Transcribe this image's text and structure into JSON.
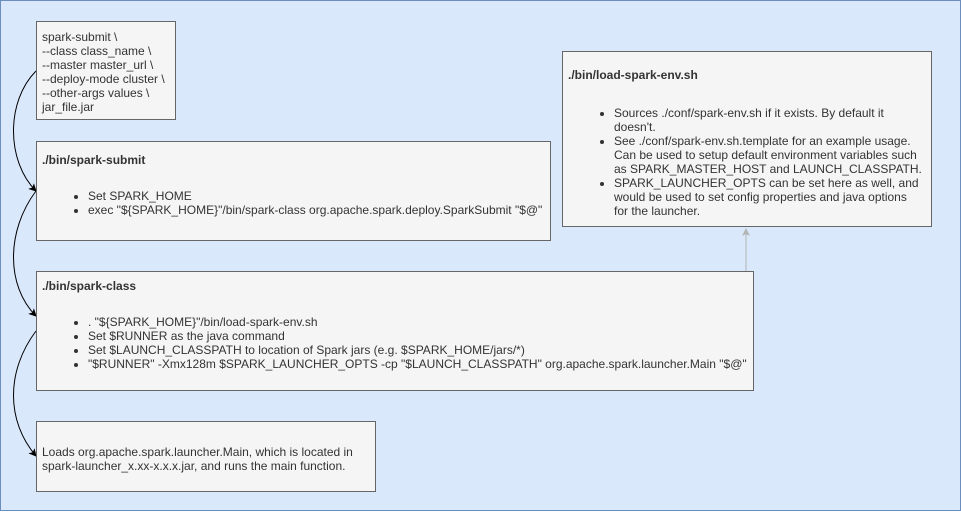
{
  "boxes": {
    "cmd": {
      "lines": [
        "spark-submit \\",
        "--class class_name \\",
        "--master master_url \\",
        "--deploy-mode cluster \\",
        "--other-args values \\",
        "jar_file.jar"
      ]
    },
    "submit": {
      "title": "./bin/spark-submit",
      "items": [
        "Set SPARK_HOME",
        "exec \"${SPARK_HOME}\"/bin/spark-class org.apache.spark.deploy.SparkSubmit \"$@\""
      ]
    },
    "class": {
      "title": "./bin/spark-class",
      "items": [
        ". \"${SPARK_HOME}\"/bin/load-spark-env.sh",
        "Set $RUNNER as the java command",
        "Set $LAUNCH_CLASSPATH to location of Spark jars (e.g. $SPARK_HOME/jars/*)",
        "\"$RUNNER\" -Xmx128m $SPARK_LAUNCHER_OPTS -cp \"$LAUNCH_CLASSPATH\" org.apache.spark.launcher.Main \"$@\""
      ]
    },
    "main": {
      "lines": [
        "Loads org.apache.spark.launcher.Main, which is located in",
        "spark-launcher_x.xx-x.x.x.jar, and runs the main function."
      ]
    },
    "env": {
      "title": "./bin/load-spark-env.sh",
      "items": [
        "Sources ./conf/spark-env.sh if it exists. By default it doesn't.",
        "See ./conf/spark-env.sh.template for an example usage. Can be used to setup default environment variables such as SPARK_MASTER_HOST and LAUNCH_CLASSPATH.",
        "SPARK_LAUNCHER_OPTS can be set here as well, and would be used to set config properties and java options for the launcher."
      ]
    }
  },
  "colors": {
    "background": "#dae8fc",
    "background_border": "#6c8ebf",
    "box_fill": "#f5f5f5",
    "box_border": "#666666",
    "text": "#333333",
    "edge_dark": "#000000",
    "edge_light": "#b3b3b3"
  }
}
